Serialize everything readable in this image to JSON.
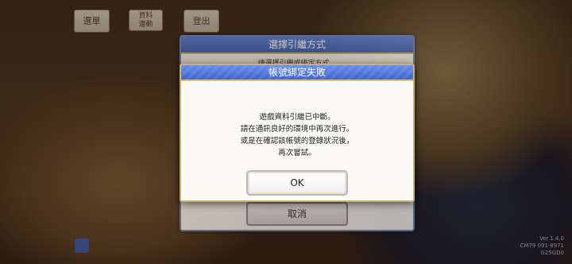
{
  "top": {
    "menu_label": "選單",
    "data_label": "資料\n連動",
    "logout_label": "登出"
  },
  "header_text": "",
  "back_dialog": {
    "title": "選擇引繼方式",
    "subtitle": "請選擇引繼或綁定方式。",
    "cancel_label": "取消"
  },
  "dialog": {
    "title": "帳號綁定失敗",
    "lines": [
      "遊戲資料引繼已中斷。",
      "請在通訊良好的環境中再次進行。",
      "或是在確認該帳號的登錄狀況後，",
      "再次嘗試。"
    ],
    "ok_label": "OK"
  },
  "version": {
    "line1": "Ver.1.4.0",
    "line2": "CM79 091 8971",
    "line3": "G25GD0"
  }
}
